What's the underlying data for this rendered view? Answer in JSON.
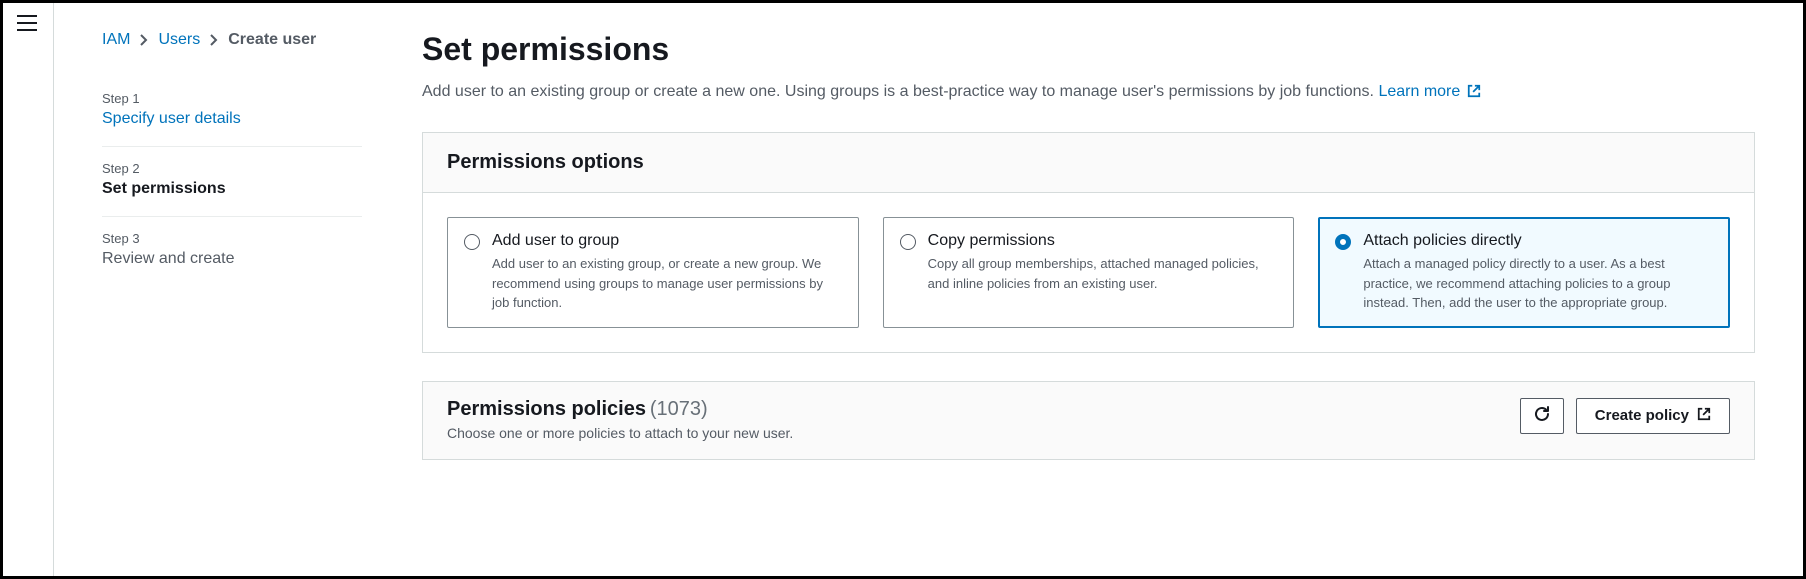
{
  "breadcrumb": {
    "items": [
      {
        "label": "IAM"
      },
      {
        "label": "Users"
      },
      {
        "label": "Create user"
      }
    ]
  },
  "steps": [
    {
      "label": "Step 1",
      "title": "Specify user details",
      "state": "done"
    },
    {
      "label": "Step 2",
      "title": "Set permissions",
      "state": "active"
    },
    {
      "label": "Step 3",
      "title": "Review and create",
      "state": "future"
    }
  ],
  "page": {
    "heading": "Set permissions",
    "subtitle_pre": "Add user to an existing group or create a new one. Using groups is a best-practice way to manage user's permissions by job functions. ",
    "learn_more": "Learn more"
  },
  "options_panel": {
    "title": "Permissions options",
    "options": [
      {
        "title": "Add user to group",
        "desc": "Add user to an existing group, or create a new group. We recommend using groups to manage user permissions by job function.",
        "selected": false
      },
      {
        "title": "Copy permissions",
        "desc": "Copy all group memberships, attached managed policies, and inline policies from an existing user.",
        "selected": false
      },
      {
        "title": "Attach policies directly",
        "desc": "Attach a managed policy directly to a user. As a best practice, we recommend attaching policies to a group instead. Then, add the user to the appropriate group.",
        "selected": true
      }
    ]
  },
  "policies_panel": {
    "title": "Permissions policies",
    "count_display": "(1073)",
    "hint": "Choose one or more policies to attach to your new user.",
    "create_button": "Create policy"
  }
}
